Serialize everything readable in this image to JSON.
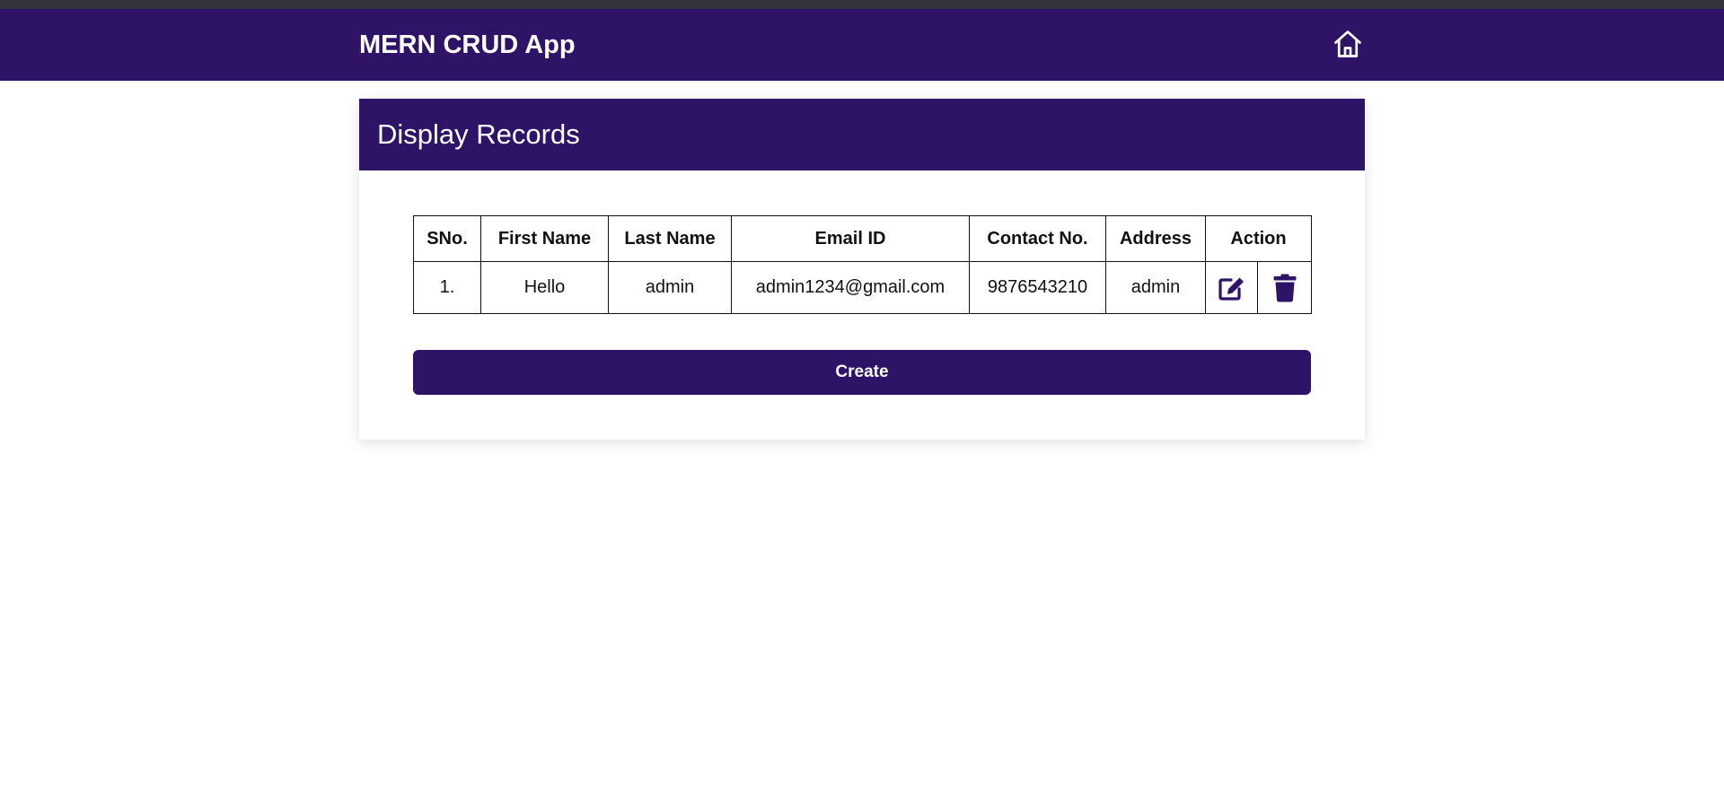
{
  "app": {
    "title": "MERN CRUD App",
    "accent_color": "#2e1367",
    "home_icon": "home-icon"
  },
  "card": {
    "title": "Display Records"
  },
  "table": {
    "headers": {
      "sno": "SNo.",
      "first_name": "First Name",
      "last_name": "Last Name",
      "email": "Email ID",
      "contact": "Contact No.",
      "address": "Address",
      "action": "Action"
    },
    "rows": [
      {
        "sno": "1.",
        "first_name": "Hello",
        "last_name": "admin",
        "email": "admin1234@gmail.com",
        "contact": "9876543210",
        "address": "admin",
        "edit_icon": "edit-icon",
        "delete_icon": "trash-icon"
      }
    ]
  },
  "actions": {
    "create_label": "Create"
  }
}
